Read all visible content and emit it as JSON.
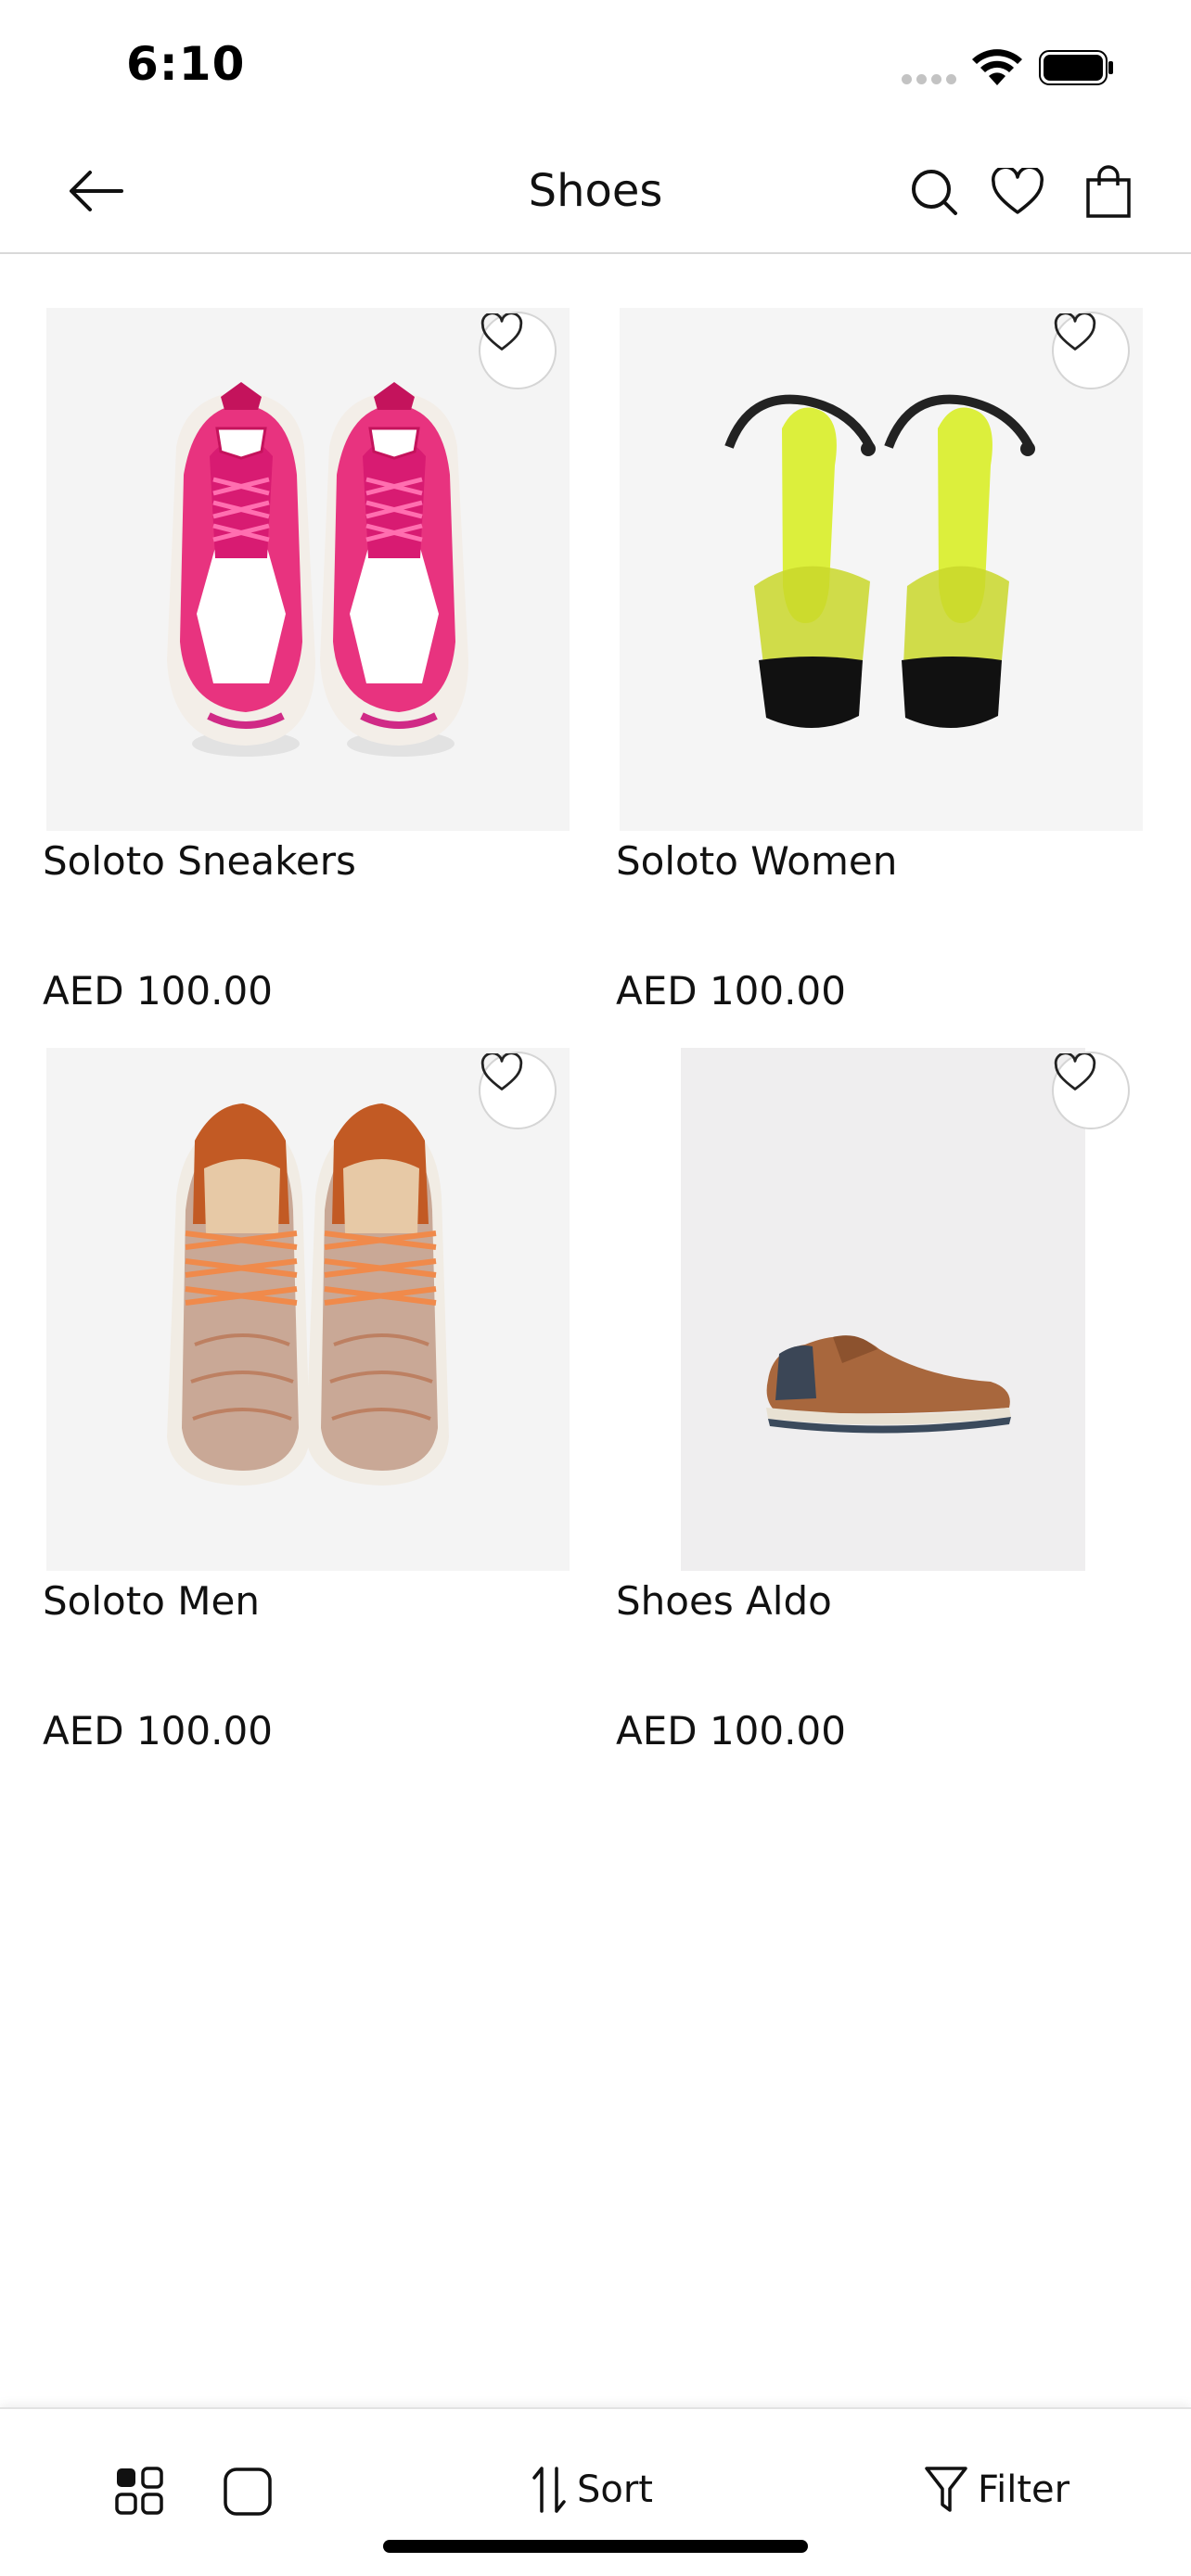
{
  "status_bar": {
    "time": "6:10"
  },
  "nav": {
    "title": "Shoes",
    "icons": [
      "back-arrow-icon",
      "search-icon",
      "heart-icon",
      "shopping-bag-icon"
    ]
  },
  "products": [
    {
      "name": "Soloto Sneakers",
      "price": "AED 100.00",
      "image": "pink-sneakers",
      "favorite": false
    },
    {
      "name": "Soloto Women",
      "price": "AED 100.00",
      "image": "lime-heeled-sandals",
      "favorite": false
    },
    {
      "name": "Soloto Men",
      "price": "AED 100.00",
      "image": "orange-knit-sneakers",
      "favorite": false
    },
    {
      "name": "Shoes Aldo",
      "price": "AED 100.00",
      "image": "brown-leather-shoe",
      "favorite": false
    }
  ],
  "toolbar": {
    "sort_label": "Sort",
    "filter_label": "Filter",
    "view_modes": [
      "grid-view-icon",
      "single-view-icon"
    ],
    "active_view": "grid"
  },
  "colors": {
    "text": "#111111",
    "divider": "#d9d9d9",
    "image_bg": "#f3f3f3"
  }
}
